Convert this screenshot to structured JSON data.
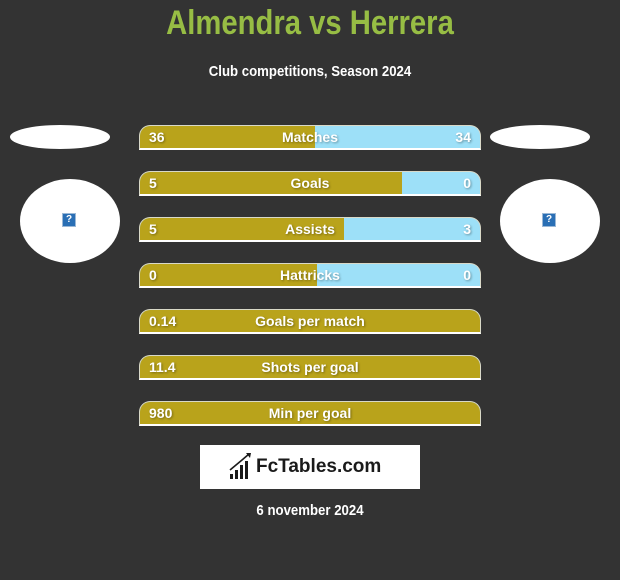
{
  "header": {
    "title": "Almendra vs Herrera",
    "subtitle": "Club competitions, Season 2024"
  },
  "players": {
    "left": {
      "name": "Almendra",
      "avatar_icon": "missing-image-icon",
      "avatar_glyph": "?"
    },
    "right": {
      "name": "Herrera",
      "avatar_icon": "missing-image-icon",
      "avatar_glyph": "?"
    }
  },
  "colors": {
    "title": "#97bd44",
    "left_bar": "#b9a31b",
    "right_bar": "#9de0f8",
    "background": "#333333"
  },
  "stats": [
    {
      "label": "Matches",
      "left": "36",
      "right": "34",
      "left_share": 0.515
    },
    {
      "label": "Goals",
      "left": "5",
      "right": "0",
      "left_share": 0.77
    },
    {
      "label": "Assists",
      "left": "5",
      "right": "3",
      "left_share": 0.6
    },
    {
      "label": "Hattricks",
      "left": "0",
      "right": "0",
      "left_share": 0.52
    },
    {
      "label": "Goals per match",
      "left": "0.14",
      "right": "",
      "left_share": 1.0
    },
    {
      "label": "Shots per goal",
      "left": "11.4",
      "right": "",
      "left_share": 1.0
    },
    {
      "label": "Min per goal",
      "left": "980",
      "right": "",
      "left_share": 1.0
    }
  ],
  "footer": {
    "logo_text": "FcTables.com",
    "logo_icon": "bar-chart-icon",
    "date": "6 november 2024"
  }
}
